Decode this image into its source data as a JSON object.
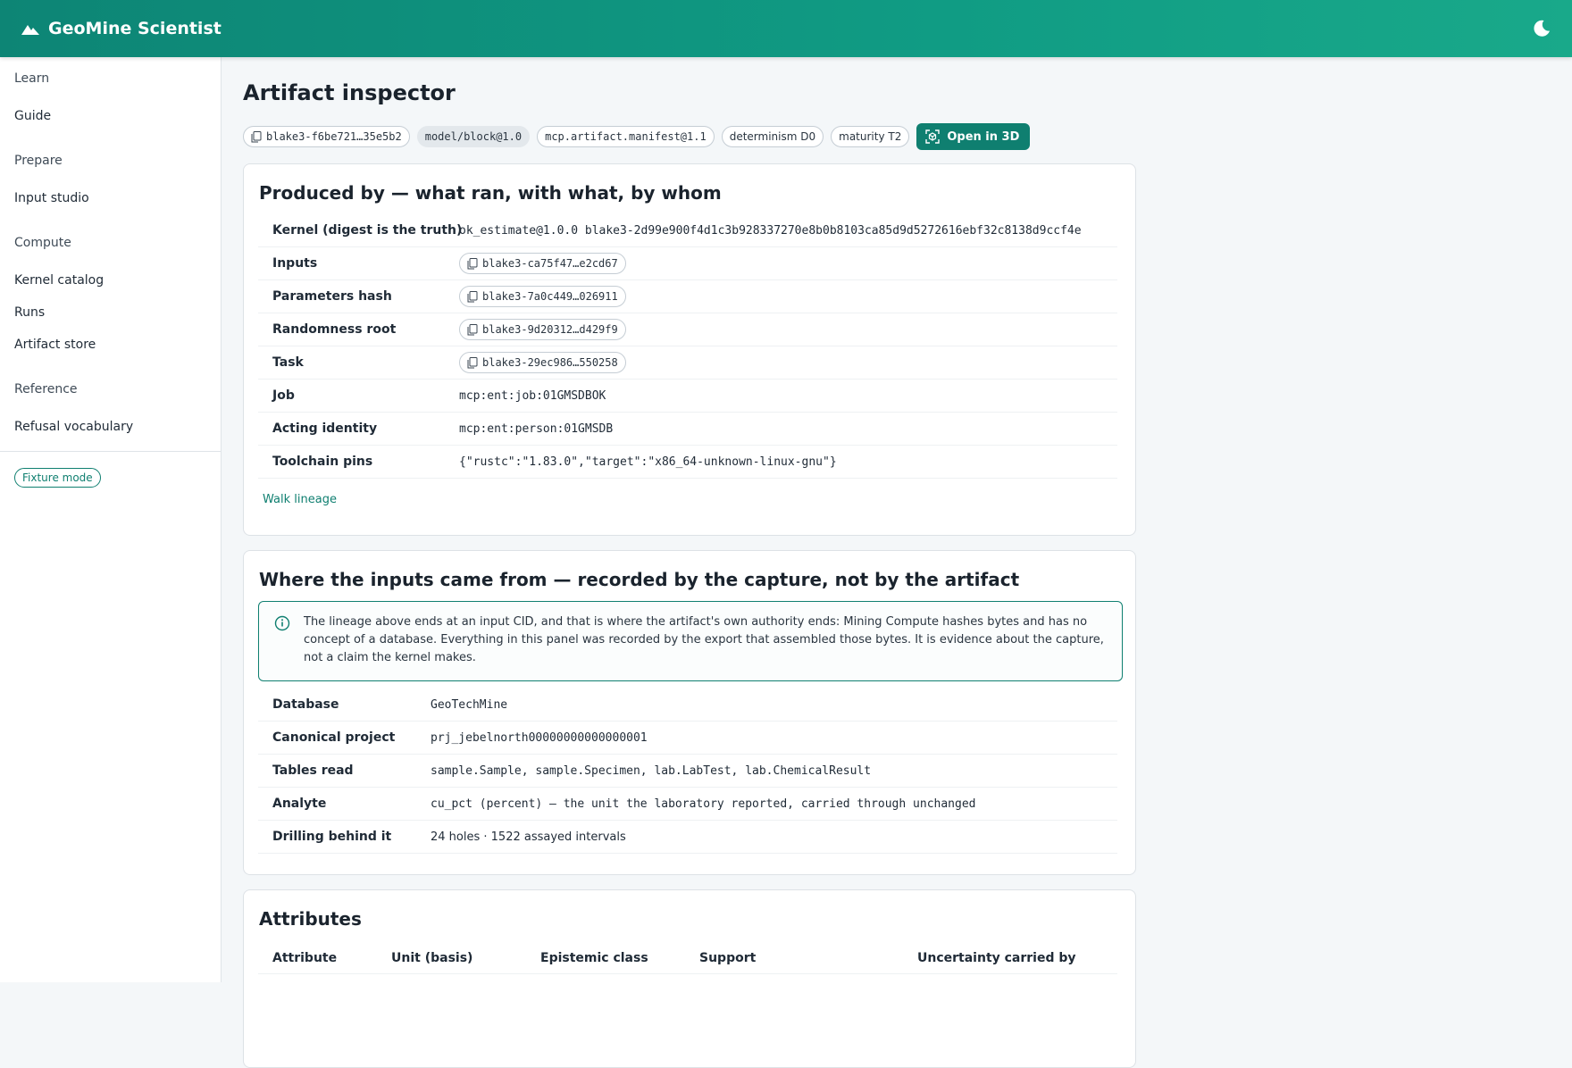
{
  "app": {
    "title": "GeoMine Scientist"
  },
  "sidebar": {
    "sections": [
      {
        "label": "Learn",
        "items": [
          "Guide"
        ]
      },
      {
        "label": "Prepare",
        "items": [
          "Input studio"
        ]
      },
      {
        "label": "Compute",
        "items": [
          "Kernel catalog",
          "Runs",
          "Artifact store"
        ]
      },
      {
        "label": "Reference",
        "items": [
          "Refusal vocabulary"
        ]
      }
    ],
    "fixture_label": "Fixture mode"
  },
  "page": {
    "title": "Artifact inspector",
    "chips": {
      "cid": "blake3-f6be721…35e5b2",
      "schema": "model/block@1.0",
      "manifest": "mcp.artifact.manifest@1.1",
      "determinism": "determinism D0",
      "maturity": "maturity T2"
    },
    "open3d_label": "Open in 3D"
  },
  "produced": {
    "title": "Produced by — what ran, with what, by whom",
    "rows": [
      {
        "key": "Kernel (digest is the truth)",
        "value": "ok_estimate@1.0.0 blake3-2d99e900f4d1c3b928337270e8b0b8103ca85d9d5272616ebf32c8138d9ccf4e"
      },
      {
        "key": "Inputs",
        "value": "blake3-ca75f47…e2cd67"
      },
      {
        "key": "Parameters hash",
        "value": "blake3-7a0c449…026911"
      },
      {
        "key": "Randomness root",
        "value": "blake3-9d20312…d429f9"
      },
      {
        "key": "Task",
        "value": "blake3-29ec986…550258"
      },
      {
        "key": "Job",
        "value": "mcp:ent:job:01GMSDBOK"
      },
      {
        "key": "Acting identity",
        "value": "mcp:ent:person:01GMSDB"
      },
      {
        "key": "Toolchain pins",
        "value": "{\"rustc\":\"1.83.0\",\"target\":\"x86_64-unknown-linux-gnu\"}"
      }
    ],
    "walk_label": "Walk lineage"
  },
  "inputs": {
    "title": "Where the inputs came from — recorded by the capture, not by the artifact",
    "info": "The lineage above ends at an input CID, and that is where the artifact's own authority ends: Mining Compute hashes bytes and has no concept of a database. Everything in this panel was recorded by the export that assembled those bytes. It is evidence about the capture, not a claim the kernel makes.",
    "rows": [
      {
        "key": "Database",
        "value": "GeoTechMine"
      },
      {
        "key": "Canonical project",
        "value": "prj_jebelnorth00000000000000001"
      },
      {
        "key": "Tables read",
        "value": "sample.Sample, sample.Specimen, lab.LabTest, lab.ChemicalResult"
      },
      {
        "key": "Analyte",
        "value": "cu_pct (percent) — the unit the laboratory reported, carried through unchanged"
      },
      {
        "key": "Drilling behind it",
        "value": "24 holes · 1522 assayed intervals"
      }
    ]
  },
  "attributes": {
    "title": "Attributes",
    "columns": [
      "Attribute",
      "Unit (basis)",
      "Epistemic class",
      "Support",
      "Uncertainty carried by"
    ]
  },
  "colors": {
    "accent": "#0f7f70",
    "header_start": "#0d8575",
    "header_end": "#19a98a"
  }
}
